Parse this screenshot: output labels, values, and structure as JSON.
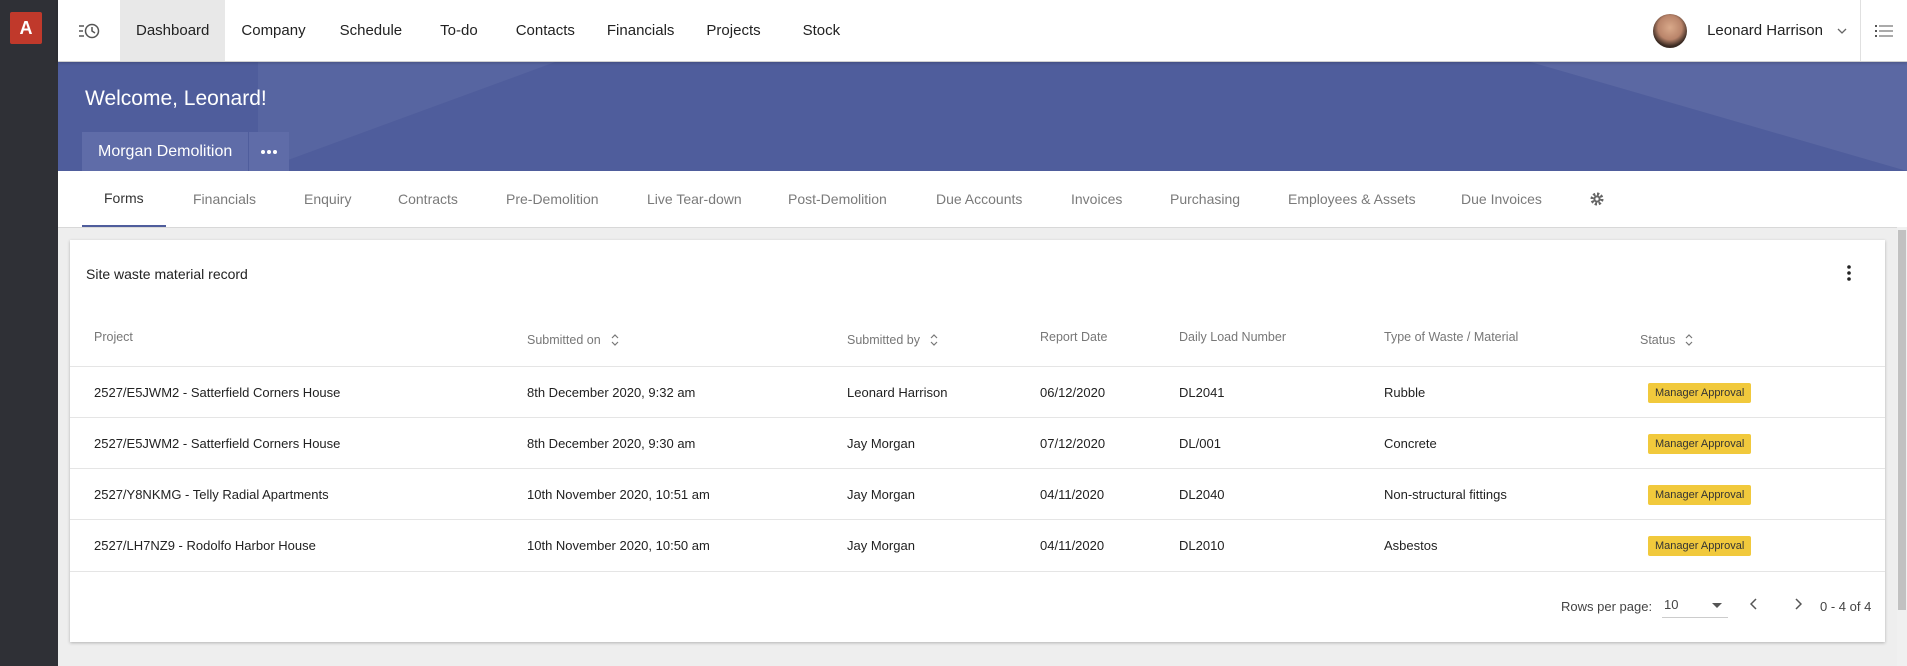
{
  "app": {
    "logo_letter": "A"
  },
  "topnav": {
    "items": [
      "Dashboard",
      "Company",
      "Schedule",
      "To-do",
      "Contacts",
      "Financials",
      "Projects",
      "Stock"
    ],
    "active_index": 0
  },
  "user": {
    "name": "Leonard Harrison"
  },
  "banner": {
    "welcome": "Welcome, Leonard!",
    "company": "Morgan Demolition",
    "color": "#4f5d9c"
  },
  "tabs": {
    "items": [
      "Forms",
      "Financials",
      "Enquiry",
      "Contracts",
      "Pre-Demolition",
      "Live Tear-down",
      "Post-Demolition",
      "Due Accounts",
      "Invoices",
      "Purchasing",
      "Employees & Assets",
      "Due Invoices"
    ],
    "active_index": 0
  },
  "card": {
    "title": "Site waste material record",
    "columns": [
      "Project",
      "Submitted on",
      "Submitted by",
      "Report Date",
      "Daily Load Number",
      "Type of Waste / Material",
      "Status"
    ],
    "rows": [
      [
        "2527/E5JWM2 - Satterfield Corners House",
        "8th December 2020, 9:32 am",
        "Leonard Harrison",
        "06/12/2020",
        "DL2041",
        "Rubble",
        "Manager Approval"
      ],
      [
        "2527/E5JWM2 - Satterfield Corners House",
        "8th December 2020, 9:30 am",
        "Jay Morgan",
        "07/12/2020",
        "DL/001",
        "Concrete",
        "Manager Approval"
      ],
      [
        "2527/Y8NKMG - Telly Radial Apartments",
        "10th November 2020, 10:51 am",
        "Jay Morgan",
        "04/11/2020",
        "DL2040",
        "Non-structural fittings",
        "Manager Approval"
      ],
      [
        "2527/LH7NZ9 - Rodolfo Harbor House",
        "10th November 2020, 10:50 am",
        "Jay Morgan",
        "04/11/2020",
        "DL2010",
        "Asbestos",
        "Manager Approval"
      ]
    ],
    "status_color": "#f1c93c"
  },
  "pagination": {
    "rows_per_page_label": "Rows per page:",
    "rows_per_page": "10",
    "range": "0 - 4 of 4"
  }
}
